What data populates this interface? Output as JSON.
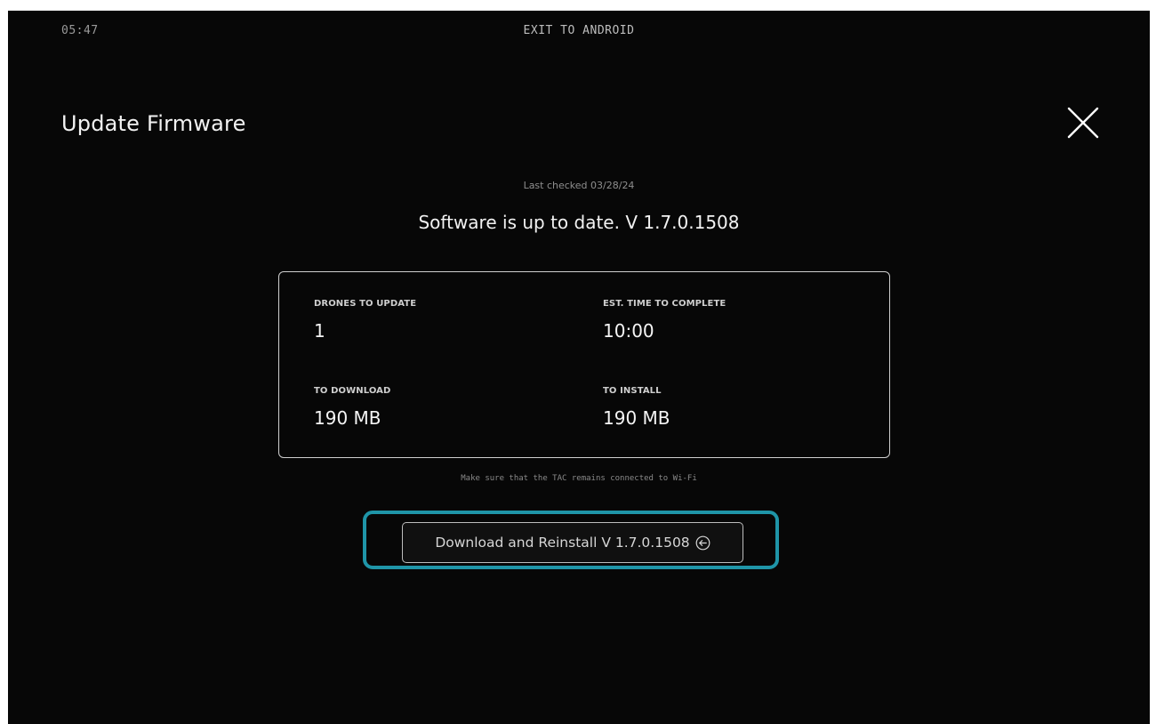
{
  "status_bar": {
    "time": "05:47",
    "exit_label": "EXIT TO ANDROID"
  },
  "header": {
    "title": "Update Firmware",
    "close_icon": "close-icon"
  },
  "update_status": {
    "last_checked": "Last checked 03/28/24",
    "message": "Software is up to date. V 1.7.0.1508"
  },
  "info_card": {
    "drones_to_update_label": "DRONES TO UPDATE",
    "drones_to_update_value": "1",
    "est_time_label": "EST. TIME TO COMPLETE",
    "est_time_value": "10:00",
    "to_download_label": "TO DOWNLOAD",
    "to_download_value": "190 MB",
    "to_install_label": "TO INSTALL",
    "to_install_value": "190 MB"
  },
  "note": "Make sure that the TAC remains connected to Wi-Fi",
  "action": {
    "button_label": "Download and Reinstall V 1.7.0.1508",
    "button_icon": "circle-arrow-left-icon",
    "highlight_color": "#1f95a8"
  }
}
